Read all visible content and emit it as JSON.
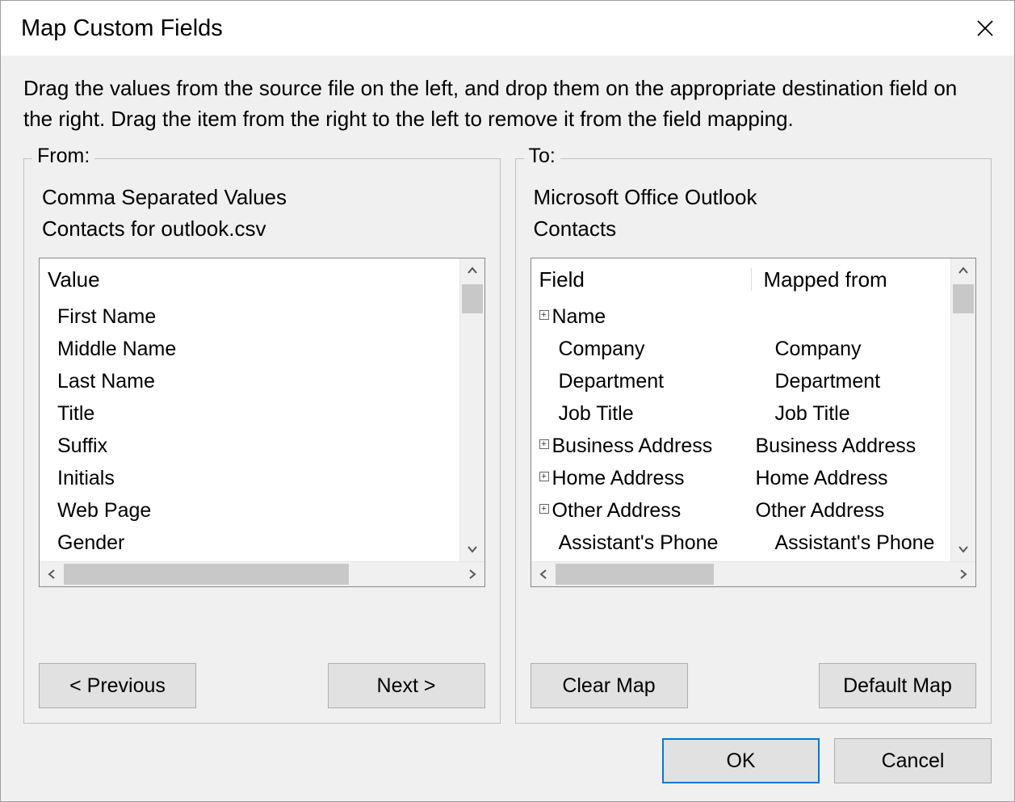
{
  "title": "Map Custom Fields",
  "instructions": "Drag the values from the source file on the left, and drop them on the appropriate destination field on the right.  Drag the item from the right to the left to remove it from the field mapping.",
  "from": {
    "legend": "From:",
    "source_type": "Comma Separated Values",
    "source_file": "Contacts for outlook.csv",
    "header": "Value",
    "items": [
      "First Name",
      "Middle Name",
      "Last Name",
      "Title",
      "Suffix",
      "Initials",
      "Web Page",
      "Gender"
    ],
    "buttons": {
      "previous": "< Previous",
      "next": "Next >"
    }
  },
  "to": {
    "legend": "To:",
    "target_app": "Microsoft Office Outlook",
    "target_folder": "Contacts",
    "header_field": "Field",
    "header_mapped": "Mapped from",
    "items": [
      {
        "field": "Name",
        "mapped": "",
        "expandable": true,
        "indent": 1
      },
      {
        "field": "Company",
        "mapped": "Company",
        "expandable": false,
        "indent": 2
      },
      {
        "field": "Department",
        "mapped": "Department",
        "expandable": false,
        "indent": 2
      },
      {
        "field": "Job Title",
        "mapped": "Job Title",
        "expandable": false,
        "indent": 2
      },
      {
        "field": "Business Address",
        "mapped": "Business Address",
        "expandable": true,
        "indent": 1
      },
      {
        "field": "Home Address",
        "mapped": "Home Address",
        "expandable": true,
        "indent": 1
      },
      {
        "field": "Other Address",
        "mapped": "Other Address",
        "expandable": true,
        "indent": 1
      },
      {
        "field": "Assistant's Phone",
        "mapped": "Assistant's Phone",
        "expandable": false,
        "indent": 2
      }
    ],
    "buttons": {
      "clear_map": "Clear Map",
      "default_map": "Default Map"
    }
  },
  "footer": {
    "ok": "OK",
    "cancel": "Cancel"
  }
}
